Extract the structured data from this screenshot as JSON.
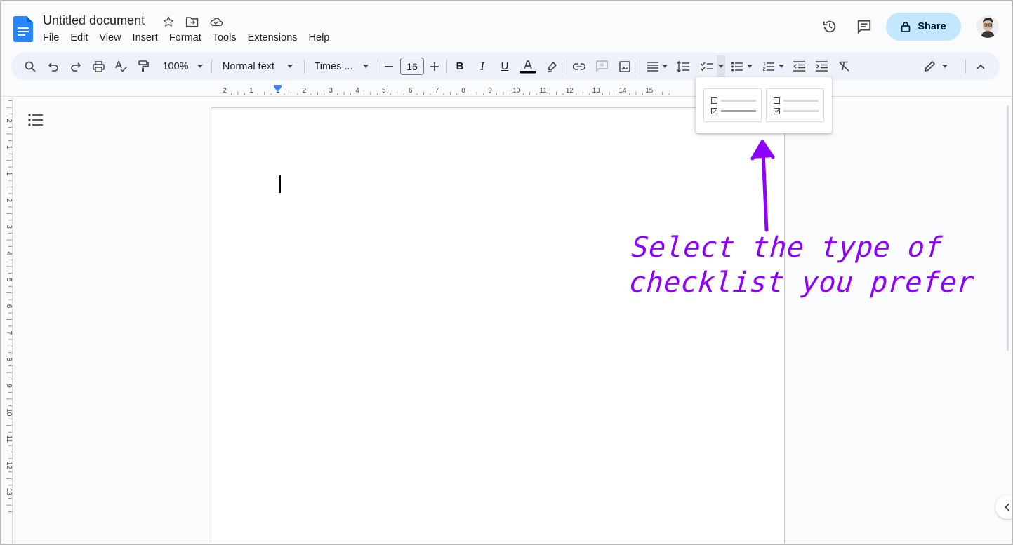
{
  "app": {
    "title": "Untitled document",
    "menu": [
      "File",
      "Edit",
      "View",
      "Insert",
      "Format",
      "Tools",
      "Extensions",
      "Help"
    ],
    "share_label": "Share"
  },
  "toolbar": {
    "zoom": "100%",
    "style": "Normal text",
    "font": "Times ...",
    "font_size": "16"
  },
  "ruler": {
    "horizontal": [
      "2",
      "1",
      "1",
      "2",
      "3",
      "4",
      "5",
      "6",
      "7",
      "8",
      "9",
      "10",
      "11",
      "12",
      "13",
      "14",
      "15"
    ],
    "vertical": [
      "2",
      "1",
      "1",
      "2",
      "3",
      "4",
      "5",
      "6",
      "7",
      "8",
      "9",
      "10",
      "11",
      "12",
      "13"
    ]
  },
  "checklist_menu": {
    "options": [
      "checklist-strikethrough",
      "checklist-plain"
    ]
  },
  "annotation": {
    "lines": [
      "Select the type of",
      "checklist you prefer"
    ],
    "color": "#8e00ff"
  },
  "colors": {
    "accent": "#0b57d0",
    "share_bg": "#c2e7ff",
    "toolbar_bg": "#edf2fa",
    "doc_logo": "#2684fc"
  }
}
